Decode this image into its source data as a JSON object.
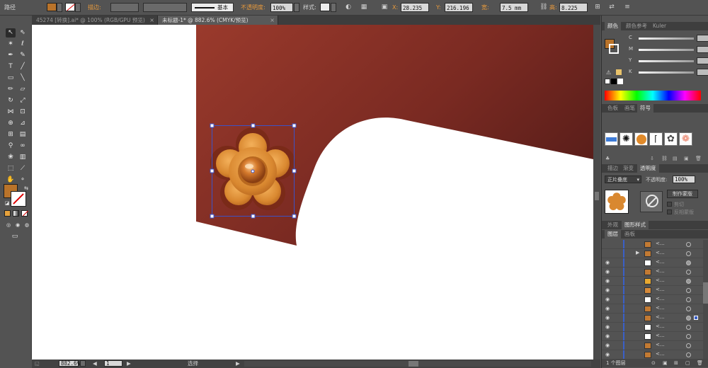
{
  "control_bar": {
    "path_label": "路径",
    "stroke_label": "描边:",
    "stroke_style": "基本",
    "opacity_label": "不透明度:",
    "opacity_value": "100%",
    "style_label": "样式:",
    "x_label": "X:",
    "x_value": "28.235 mm",
    "y_label": "Y:",
    "y_value": "216.196",
    "w_label": "宽:",
    "w_value": "7.5 mm",
    "h_label": "高:",
    "h_value": "8.225 mm"
  },
  "tabs": [
    {
      "label": "45274 [转换].ai* @ 100% (RGB/GPU 预览)"
    },
    {
      "label": "未标题-1* @ 882.6% (CMYK/预览)"
    }
  ],
  "status_bar": {
    "zoom": "882.6%",
    "page": "1",
    "mode": "选择"
  },
  "color_panel": {
    "tabs": [
      "颜色",
      "颜色参考",
      "Kuler"
    ],
    "channels": [
      "C",
      "M",
      "Y",
      "K"
    ],
    "unit": "%"
  },
  "symbols_panel": {
    "tabs": [
      "色板",
      "画笔",
      "符号"
    ]
  },
  "transparency_panel": {
    "tabs": [
      "描边",
      "渐变",
      "透明度"
    ],
    "blend_mode": "正片叠底",
    "opacity_label": "不透明度:",
    "opacity_value": "100%",
    "make_mask_button": "制作蒙版",
    "clip_label": "剪切",
    "invert_label": "反相蒙版"
  },
  "appearance_panel": {
    "tabs": [
      "外观",
      "图形样式"
    ]
  },
  "layers_panel": {
    "tabs": [
      "图层",
      "画板"
    ],
    "row_label": "<...",
    "footer": "1 个图层"
  },
  "colors": {
    "fill": "#b9732a",
    "flower_outer": "#7a2a18",
    "flower_main": "#e2963c",
    "bg_shape": "#8a3228"
  }
}
